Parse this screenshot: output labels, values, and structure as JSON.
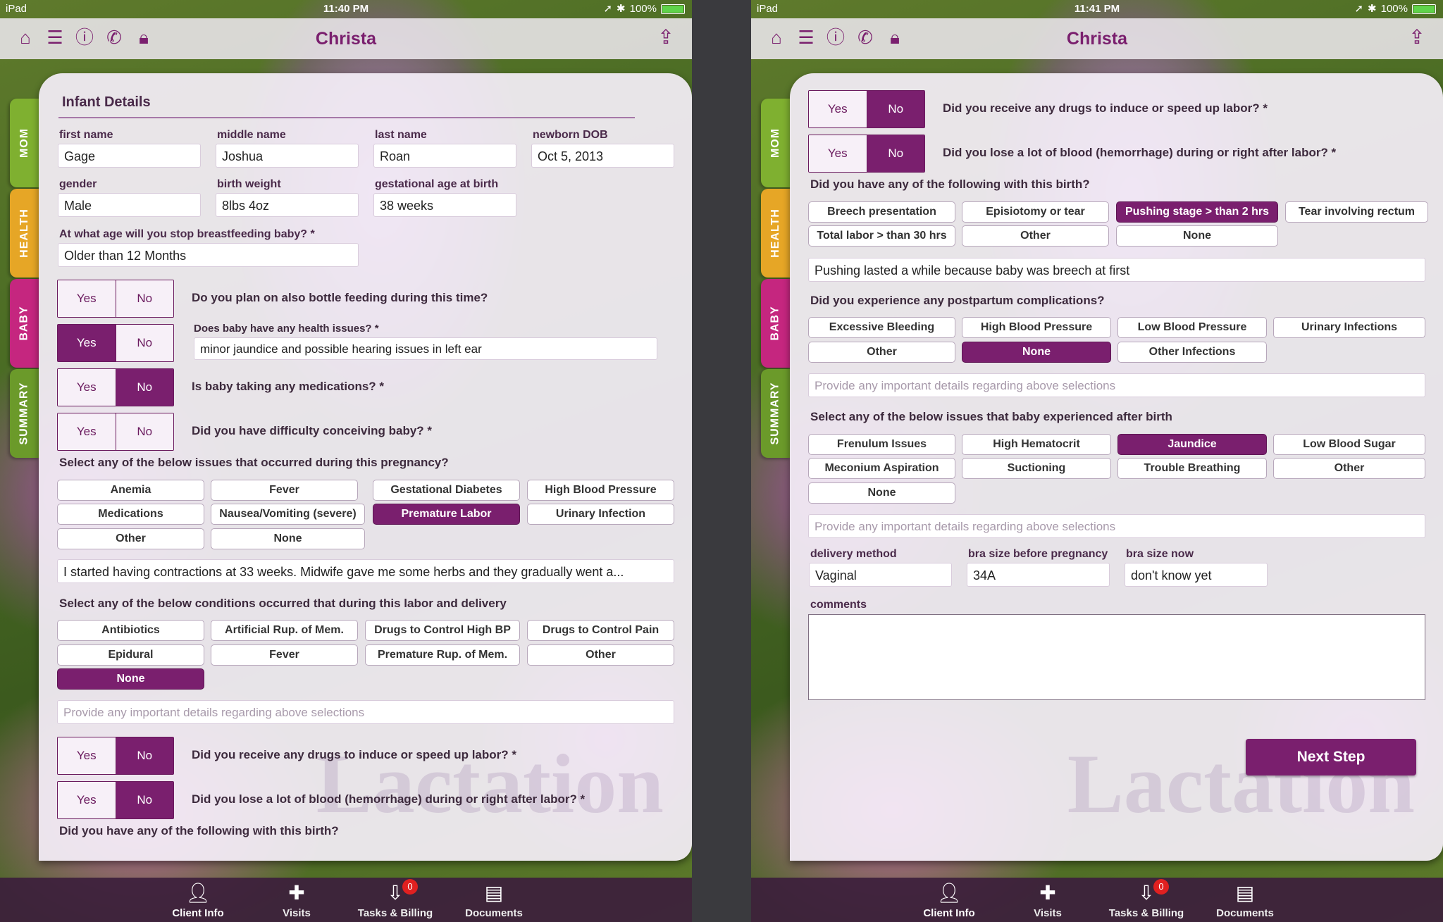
{
  "status": {
    "carrier": "iPad",
    "time_left": "11:40 PM",
    "time_right": "11:41 PM",
    "battery": "100%"
  },
  "nav": {
    "title": "Christa"
  },
  "sidetabs": [
    "MOM",
    "HEALTH",
    "BABY",
    "SUMMARY"
  ],
  "tabbar": [
    {
      "label": "Client Info",
      "icon": "person-icon"
    },
    {
      "label": "Visits",
      "icon": "medical-bag-icon"
    },
    {
      "label": "Tasks & Billing",
      "icon": "inbox-icon",
      "badge": "0"
    },
    {
      "label": "Documents",
      "icon": "cabinet-icon"
    }
  ],
  "yes_label": "Yes",
  "no_label": "No",
  "left": {
    "section_title": "Infant Details",
    "fields": {
      "first_name": {
        "label": "first name",
        "value": "Gage"
      },
      "middle_name": {
        "label": "middle name",
        "value": "Joshua"
      },
      "last_name": {
        "label": "last name",
        "value": "Roan"
      },
      "newborn_dob": {
        "label": "newborn DOB",
        "value": "Oct 5, 2013"
      },
      "gender": {
        "label": "gender",
        "value": "Male"
      },
      "birth_weight": {
        "label": "birth weight",
        "value": "8lbs 4oz"
      },
      "gestational_age": {
        "label": "gestational age at birth",
        "value": "38 weeks"
      }
    },
    "breastfeeding_question": "At what age will you stop breastfeeding baby? *",
    "breastfeeding_value": "Older than 12 Months",
    "q_bottle": "Do you plan on also bottle feeding during this time?",
    "q_health_issues": "Does baby have any health issues? *",
    "health_issues_value": "minor jaundice and possible hearing issues in left ear",
    "q_medications": "Is baby taking any medications? *",
    "q_conceiving": "Did you have difficulty conceiving baby? *",
    "pregnancy_issues_title": "Select any of the below issues that occurred during this pregnancy?",
    "pregnancy_chips": [
      "Anemia",
      "Fever",
      "Gestational Diabetes",
      "High Blood Pressure",
      "Medications",
      "Nausea/Vomiting (severe)",
      "Premature Labor",
      "Urinary Infection",
      "Other",
      "None"
    ],
    "pregnancy_details": "I started having contractions at 33 weeks. Midwife gave me some herbs and they gradually went a...",
    "labor_conditions_title": "Select any of the below conditions occurred that during this labor and delivery",
    "labor_chips": [
      "Antibiotics",
      "Artificial Rup. of Mem.",
      "Drugs to Control High BP",
      "Drugs to Control Pain",
      "Epidural",
      "Fever",
      "Premature Rup. of Mem.",
      "Other",
      "None"
    ],
    "details_placeholder": "Provide any important details regarding above selections",
    "q_drugs_induce": "Did you receive any drugs to induce or speed up labor? *",
    "q_blood_loss": "Did you lose a lot of blood (hemorrhage) during or right after labor? *",
    "birth_following_title": "Did you have any of the following with this birth?"
  },
  "right": {
    "q_drugs_induce": "Did you receive any drugs to induce or speed up labor? *",
    "q_blood_loss": "Did you lose a lot of blood (hemorrhage) during or right after labor? *",
    "birth_following_title": "Did you have any of the following with this birth?",
    "birth_chips": [
      "Breech presentation",
      "Episiotomy or tear",
      "Pushing stage > than 2 hrs",
      "Tear involving rectum",
      "Total labor > than 30 hrs",
      "Other",
      "None"
    ],
    "birth_details": "Pushing lasted a while because baby was breech at first",
    "postpartum_title": "Did you experience any postpartum complications?",
    "postpartum_chips": [
      "Excessive Bleeding",
      "High Blood Pressure",
      "Low Blood Pressure",
      "Urinary Infections",
      "Other",
      "None",
      "Other Infections"
    ],
    "details_placeholder_1": "Provide any important details regarding above selections",
    "baby_issues_title": "Select any of the below issues that baby experienced after birth",
    "baby_chips": [
      "Frenulum Issues",
      "High Hematocrit",
      "Jaundice",
      "Low Blood Sugar",
      "Meconium Aspiration",
      "Suctioning",
      "Trouble Breathing",
      "Other",
      "None"
    ],
    "details_placeholder_2": "Provide any important details regarding above selections",
    "delivery_method": {
      "label": "delivery method",
      "value": "Vaginal"
    },
    "bra_before": {
      "label": "bra size before pregnancy",
      "value": "34A"
    },
    "bra_now": {
      "label": "bra size now",
      "value": "don't know yet"
    },
    "comments_label": "comments",
    "next_button": "Next Step"
  }
}
